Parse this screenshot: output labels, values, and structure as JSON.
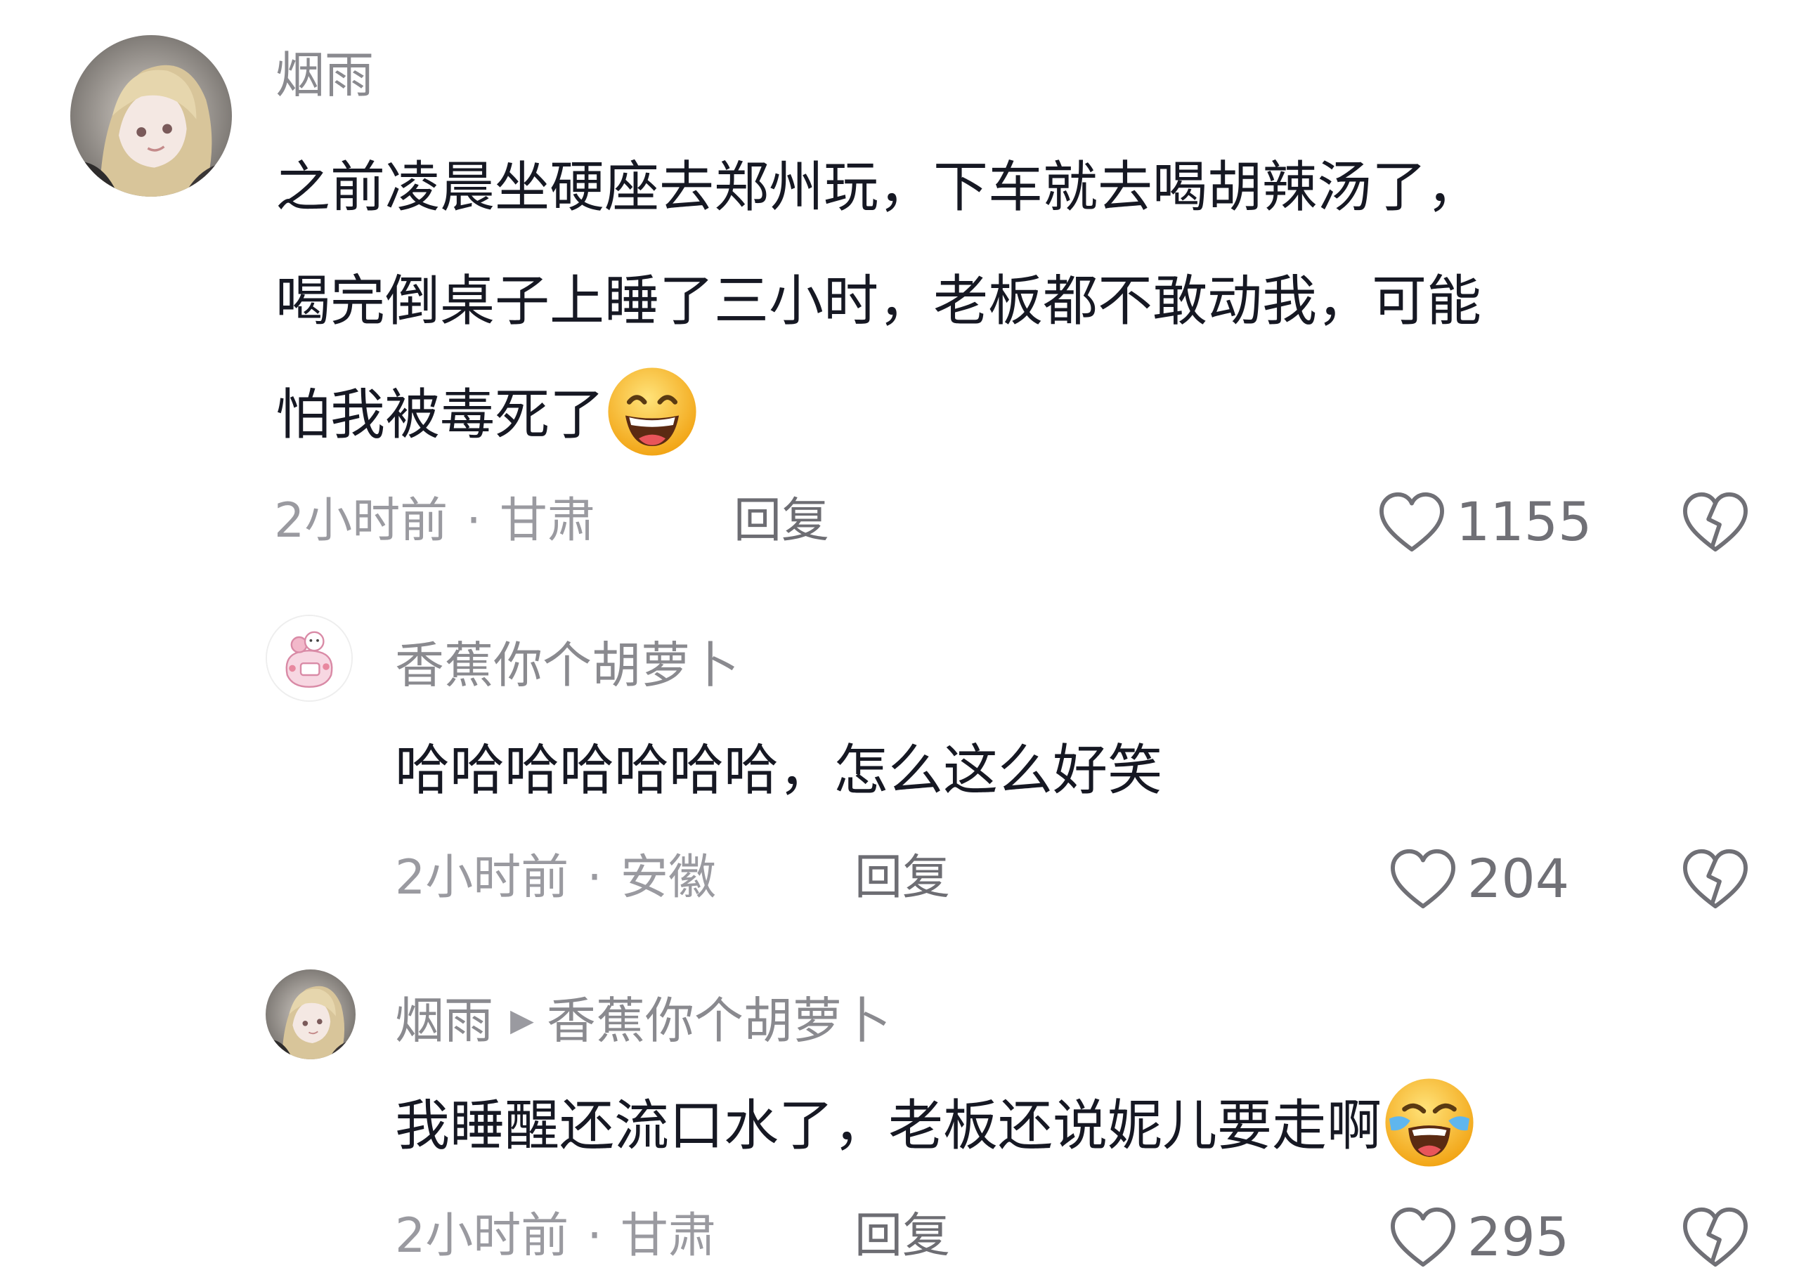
{
  "comments": [
    {
      "username": "烟雨",
      "lines": [
        "之前凌晨坐硬座去郑州玩，下车就去喝胡辣汤了，",
        "喝完倒桌子上睡了三小时，老板都不敢动我，可能",
        "怕我被毒死了"
      ],
      "emoji": "grinning-squint-emoji",
      "time": "2小时前",
      "location": "甘肃",
      "reply_label": "回复",
      "likes": "1155"
    },
    {
      "username": "香蕉你个胡萝卜",
      "lines": [
        "哈哈哈哈哈哈哈，怎么这么好笑"
      ],
      "time": "2小时前",
      "location": "安徽",
      "reply_label": "回复",
      "likes": "204"
    },
    {
      "username": "烟雨",
      "reply_to": "香蕉你个胡萝卜",
      "lines": [
        "我睡醒还流口水了，老板还说妮儿要走啊"
      ],
      "emoji": "tears-of-joy-emoji",
      "time": "2小时前",
      "location": "甘肃",
      "reply_label": "回复",
      "likes": "295"
    }
  ],
  "separator": "·",
  "icons": {
    "like": "heart-outline-icon",
    "dislike": "broken-heart-icon",
    "reply_arrow": "caret-right-icon"
  },
  "colors": {
    "text": "#161823",
    "secondary": "#8a8a8f",
    "icon": "#707076"
  }
}
